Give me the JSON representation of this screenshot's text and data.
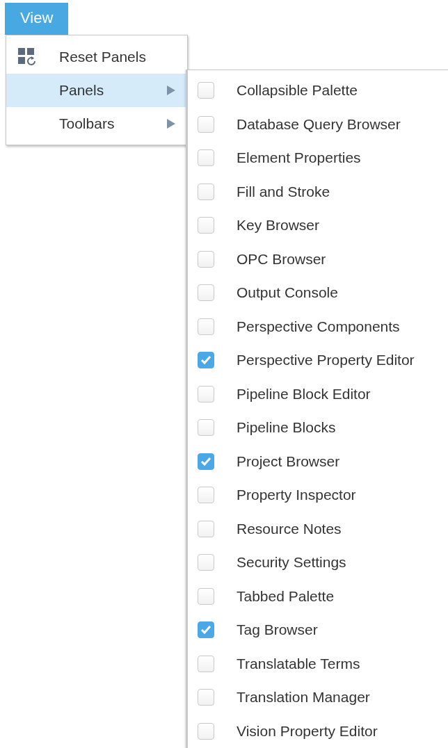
{
  "menu_bar": [
    {
      "label": "View",
      "selected": true
    }
  ],
  "view_menu": [
    {
      "label": "Reset Panels",
      "kind": "action",
      "selected": false
    },
    {
      "label": "Panels",
      "kind": "submenu",
      "selected": true
    },
    {
      "label": "Toolbars",
      "kind": "submenu",
      "selected": false
    }
  ],
  "panels_submenu": [
    {
      "label": "Collapsible Palette",
      "checked": false
    },
    {
      "label": "Database Query Browser",
      "checked": false
    },
    {
      "label": "Element Properties",
      "checked": false
    },
    {
      "label": "Fill and Stroke",
      "checked": false
    },
    {
      "label": "Key Browser",
      "checked": false
    },
    {
      "label": "OPC Browser",
      "checked": false
    },
    {
      "label": "Output Console",
      "checked": false
    },
    {
      "label": "Perspective Components",
      "checked": false
    },
    {
      "label": "Perspective Property Editor",
      "checked": true
    },
    {
      "label": "Pipeline Block Editor",
      "checked": false
    },
    {
      "label": "Pipeline Blocks",
      "checked": false
    },
    {
      "label": "Project Browser",
      "checked": true
    },
    {
      "label": "Property Inspector",
      "checked": false
    },
    {
      "label": "Resource Notes",
      "checked": false
    },
    {
      "label": "Security Settings",
      "checked": false
    },
    {
      "label": "Tabbed Palette",
      "checked": false
    },
    {
      "label": "Tag Browser",
      "checked": true
    },
    {
      "label": "Translatable Terms",
      "checked": false
    },
    {
      "label": "Translation Manager",
      "checked": false
    },
    {
      "label": "Vision Property Editor",
      "checked": false
    }
  ]
}
